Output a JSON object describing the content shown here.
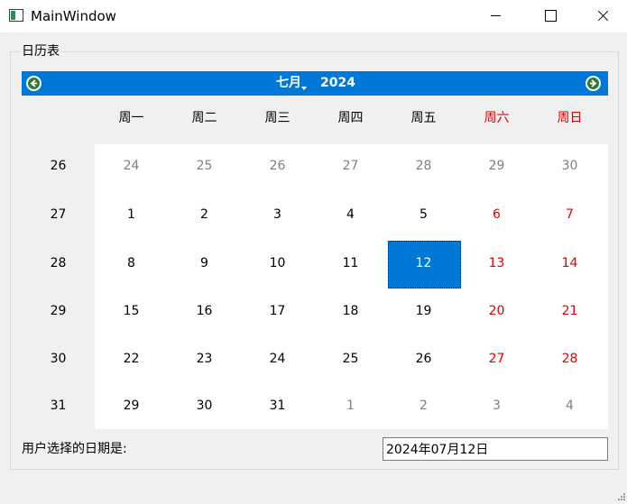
{
  "window": {
    "title": "MainWindow"
  },
  "groupbox": {
    "title": "日历表"
  },
  "calendar": {
    "month": "七月",
    "year": "2024",
    "weekdays": [
      "周一",
      "周二",
      "周三",
      "周四",
      "周五",
      "周六",
      "周日"
    ],
    "week_numbers": [
      "26",
      "27",
      "28",
      "29",
      "30",
      "31"
    ],
    "days": [
      [
        "24",
        "25",
        "26",
        "27",
        "28",
        "29",
        "30"
      ],
      [
        "1",
        "2",
        "3",
        "4",
        "5",
        "6",
        "7"
      ],
      [
        "8",
        "9",
        "10",
        "11",
        "12",
        "13",
        "14"
      ],
      [
        "15",
        "16",
        "17",
        "18",
        "19",
        "20",
        "21"
      ],
      [
        "22",
        "23",
        "24",
        "25",
        "26",
        "27",
        "28"
      ],
      [
        "29",
        "30",
        "31",
        "1",
        "2",
        "3",
        "4"
      ]
    ],
    "selected_day": "12",
    "colors": {
      "nav_bar": "#0078d7",
      "weekend": "#e00000",
      "other_month": "#808080",
      "selection": "#0078d7"
    }
  },
  "selection": {
    "label": "用户选择的日期是:",
    "value": "2024年07月12日"
  }
}
